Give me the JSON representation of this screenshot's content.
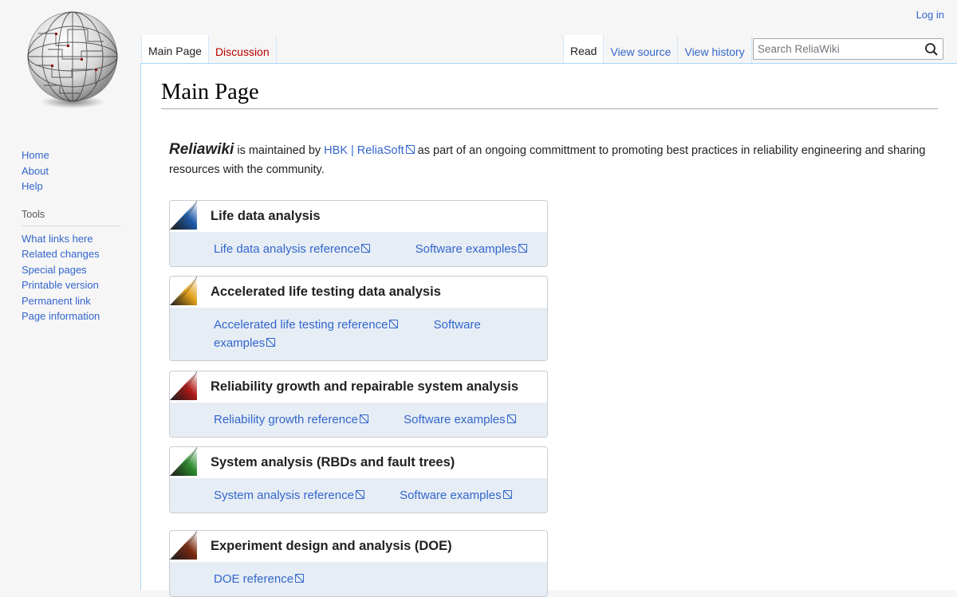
{
  "personal": {
    "login": "Log in"
  },
  "sidebar": {
    "navigation": [
      {
        "label": "Home"
      },
      {
        "label": "About"
      },
      {
        "label": "Help"
      }
    ],
    "tools_heading": "Tools",
    "tools": [
      {
        "label": "What links here"
      },
      {
        "label": "Related changes"
      },
      {
        "label": "Special pages"
      },
      {
        "label": "Printable version"
      },
      {
        "label": "Permanent link"
      },
      {
        "label": "Page information"
      }
    ]
  },
  "tabs": {
    "namespaces": [
      {
        "label": "Main Page",
        "selected": true
      },
      {
        "label": "Discussion",
        "selected": false
      }
    ],
    "views": [
      {
        "label": "Read",
        "selected": true
      },
      {
        "label": "View source",
        "selected": false
      },
      {
        "label": "View history",
        "selected": false
      }
    ]
  },
  "search": {
    "placeholder": "Search ReliaWiki"
  },
  "page": {
    "title": "Main Page",
    "intro": {
      "brand": "Reliawiki",
      "text1": " is maintained by ",
      "link": "HBK | ReliaSoft",
      "text2": " as part of an ongoing committment to promoting best practices in reliability engineering and sharing resources with the community."
    },
    "sections": [
      {
        "title": "Life data analysis",
        "flag_color": "#1e5aa8",
        "links": [
          "Life data analysis reference",
          "Software examples"
        ]
      },
      {
        "title": "Accelerated life testing data analysis",
        "flag_color": "#e3a21a",
        "links": [
          "Accelerated life testing reference",
          "Software examples"
        ]
      },
      {
        "title": "Reliability growth and repairable system analysis",
        "flag_color": "#b01818",
        "links": [
          "Reliability growth reference",
          "Software examples"
        ]
      },
      {
        "title": "System analysis (RBDs and fault trees)",
        "flag_color": "#2e8b2e",
        "links": [
          "System analysis reference",
          "Software examples"
        ]
      },
      {
        "title": "Experiment design and analysis (DOE)",
        "flag_color": "#7a2a10",
        "links": [
          "DOE reference"
        ]
      }
    ]
  }
}
